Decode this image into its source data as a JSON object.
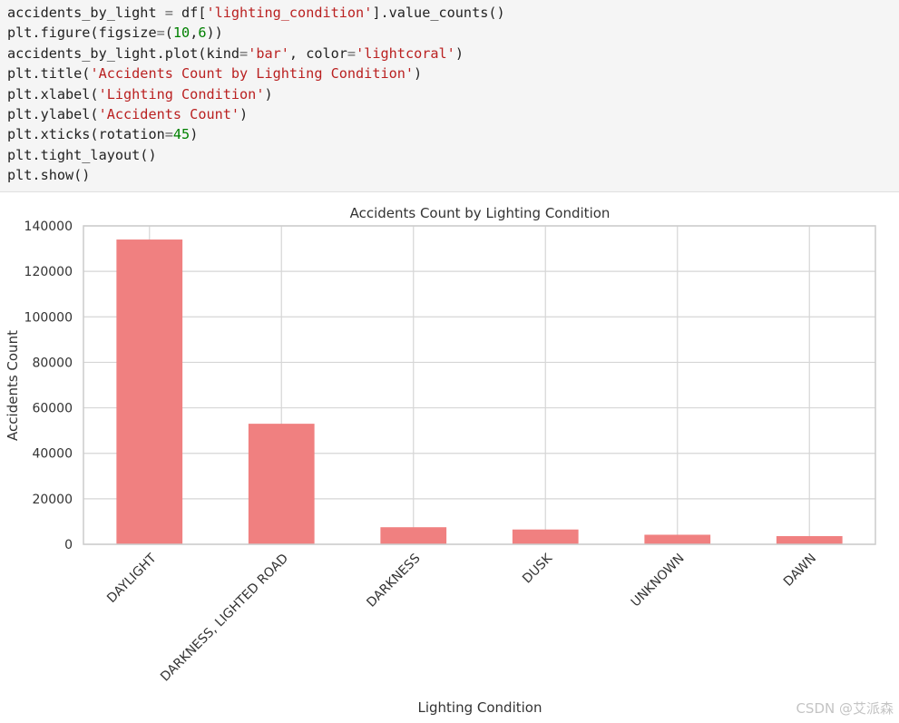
{
  "code_cell": {
    "lines": [
      [
        {
          "t": "accidents_by_light ",
          "c": ""
        },
        {
          "t": "=",
          "c": "o"
        },
        {
          "t": " df[",
          "c": ""
        },
        {
          "t": "'lighting_condition'",
          "c": "s"
        },
        {
          "t": "].value_counts()",
          "c": ""
        }
      ],
      [
        {
          "t": "plt.figure(figsize",
          "c": ""
        },
        {
          "t": "=",
          "c": "o"
        },
        {
          "t": "(",
          "c": ""
        },
        {
          "t": "10",
          "c": "n"
        },
        {
          "t": ",",
          "c": ""
        },
        {
          "t": "6",
          "c": "n"
        },
        {
          "t": "))",
          "c": ""
        }
      ],
      [
        {
          "t": "accidents_by_light.plot(kind",
          "c": ""
        },
        {
          "t": "=",
          "c": "o"
        },
        {
          "t": "'bar'",
          "c": "s"
        },
        {
          "t": ", color",
          "c": ""
        },
        {
          "t": "=",
          "c": "o"
        },
        {
          "t": "'lightcoral'",
          "c": "s"
        },
        {
          "t": ")",
          "c": ""
        }
      ],
      [
        {
          "t": "plt.title(",
          "c": ""
        },
        {
          "t": "'Accidents Count by Lighting Condition'",
          "c": "s"
        },
        {
          "t": ")",
          "c": ""
        }
      ],
      [
        {
          "t": "plt.xlabel(",
          "c": ""
        },
        {
          "t": "'Lighting Condition'",
          "c": "s"
        },
        {
          "t": ")",
          "c": ""
        }
      ],
      [
        {
          "t": "plt.ylabel(",
          "c": ""
        },
        {
          "t": "'Accidents Count'",
          "c": "s"
        },
        {
          "t": ")",
          "c": ""
        }
      ],
      [
        {
          "t": "plt.xticks(rotation",
          "c": ""
        },
        {
          "t": "=",
          "c": "o"
        },
        {
          "t": "45",
          "c": "n"
        },
        {
          "t": ")",
          "c": ""
        }
      ],
      [
        {
          "t": "plt.tight_layout()",
          "c": ""
        }
      ],
      [
        {
          "t": "plt.show()",
          "c": ""
        }
      ]
    ]
  },
  "chart_data": {
    "type": "bar",
    "title": "Accidents Count by Lighting Condition",
    "xlabel": "Lighting Condition",
    "ylabel": "Accidents Count",
    "categories": [
      "DAYLIGHT",
      "DARKNESS, LIGHTED ROAD",
      "DARKNESS",
      "DUSK",
      "UNKNOWN",
      "DAWN"
    ],
    "values": [
      134000,
      53000,
      7500,
      6500,
      4200,
      3600
    ],
    "ylim": [
      0,
      140000
    ],
    "yticks": [
      "0",
      "20000",
      "40000",
      "60000",
      "80000",
      "100000",
      "120000",
      "140000"
    ],
    "xtick_rotation_deg": 45,
    "grid": true,
    "bar_color": "#f08080",
    "grid_color": "#d6d6d6",
    "text_color": "#333333"
  },
  "watermark": "CSDN @艾派森"
}
